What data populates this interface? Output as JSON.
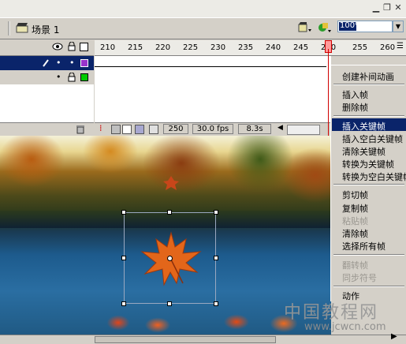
{
  "toolbar": {
    "scene_label": "场景 1",
    "zoom_value": "100%"
  },
  "timeline": {
    "ruler_labels": [
      "210",
      "215",
      "220",
      "225",
      "230",
      "235",
      "240",
      "245",
      "250",
      "255",
      "260"
    ],
    "status": {
      "current_frame": "250",
      "frame_rate": "30.0 fps",
      "elapsed_time": "8.3s"
    }
  },
  "context_menu": {
    "items": [
      {
        "label": "创建补间动画",
        "enabled": true
      },
      {
        "label": "插入帧",
        "enabled": true
      },
      {
        "label": "删除帧",
        "enabled": true
      },
      {
        "label": "插入关键帧",
        "enabled": true,
        "highlighted": true
      },
      {
        "label": "插入空白关键帧",
        "enabled": true
      },
      {
        "label": "清除关键帧",
        "enabled": true
      },
      {
        "label": "转换为关键帧",
        "enabled": true
      },
      {
        "label": "转换为空白关键帧",
        "enabled": true
      },
      {
        "label": "剪切帧",
        "enabled": true
      },
      {
        "label": "复制帧",
        "enabled": true
      },
      {
        "label": "粘贴帧",
        "enabled": false
      },
      {
        "label": "清除帧",
        "enabled": true
      },
      {
        "label": "选择所有帧",
        "enabled": true
      },
      {
        "label": "翻转帧",
        "enabled": false
      },
      {
        "label": "同步符号",
        "enabled": false
      },
      {
        "label": "动作",
        "enabled": true
      }
    ],
    "highlight_color": "#0a246a"
  },
  "watermark": {
    "title": "中国教程网",
    "url": "www.jcwcn.com"
  },
  "colors": {
    "selected_layer": "#0a246a",
    "playhead": "#d00000",
    "layer1_outline": "#9933cc",
    "layer2_outline": "#00cc00"
  }
}
